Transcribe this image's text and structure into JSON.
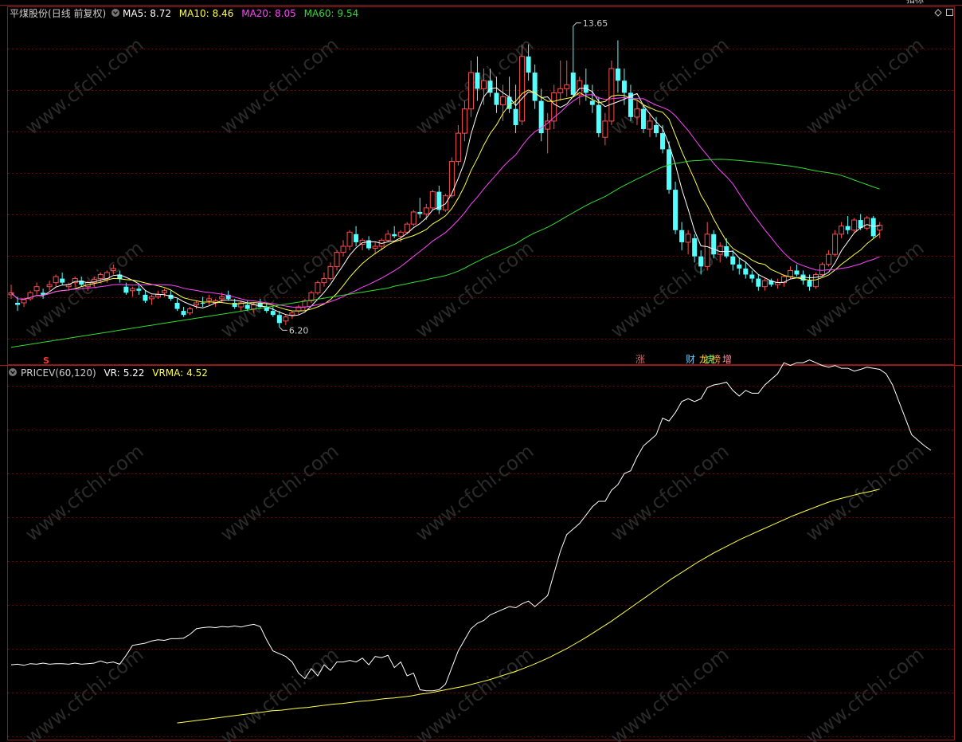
{
  "stock": {
    "name": "平煤股份",
    "period": "(日线 前复权)"
  },
  "toolbar_right": [
    "指标"
  ],
  "colors": {
    "background": "#000000",
    "grid": "#7a0000",
    "frame": "#8c1a1a",
    "up": "#ff4d4d",
    "down": "#54ffff",
    "ma5": "#ffffff",
    "ma10": "#ffff44",
    "ma20": "#ff44ff",
    "ma60": "#33dd33",
    "vr": "#ffffff",
    "vrma": "#ffff44",
    "label_grey": "#cccccc"
  },
  "main_indicators": [
    {
      "label": "MA5:",
      "value": "8.72",
      "color": "#ffffff"
    },
    {
      "label": "MA10:",
      "value": "8.46",
      "color": "#ffff44"
    },
    {
      "label": "MA20:",
      "value": "8.05",
      "color": "#ff44ff"
    },
    {
      "label": "MA60:",
      "value": "9.54",
      "color": "#33dd33"
    }
  ],
  "sub_indicator": {
    "name": "PRICEV(60,120)",
    "items": [
      {
        "label": "VR:",
        "value": "5.22",
        "color": "#ffffff"
      },
      {
        "label": "VRMA:",
        "value": "4.52",
        "color": "#ffff44"
      }
    ]
  },
  "markers": {
    "high_label": "13.65",
    "low_label": "6.20",
    "s_label": "S",
    "zhang": "涨",
    "cai": "财",
    "long": "龙",
    "hu": "虎",
    "bang": "榜",
    "zeng": "增"
  },
  "watermark": "www.cfchi.com",
  "chart_data": [
    {
      "type": "candlestick",
      "title": "平煤股份 (日线 前复权)",
      "price_range": [
        5.3,
        14.1
      ],
      "high": {
        "index": 88,
        "value": 13.65
      },
      "low": {
        "index": 42,
        "value": 6.2
      },
      "candles": [
        [
          7.0,
          7.25,
          6.9,
          7.05
        ],
        [
          6.8,
          6.95,
          6.6,
          6.75
        ],
        [
          6.8,
          6.9,
          6.7,
          6.88
        ],
        [
          6.9,
          7.1,
          6.85,
          7.05
        ],
        [
          7.1,
          7.3,
          7.0,
          7.2
        ],
        [
          7.05,
          7.15,
          6.9,
          7.0
        ],
        [
          7.2,
          7.35,
          7.1,
          7.25
        ],
        [
          7.3,
          7.5,
          7.2,
          7.45
        ],
        [
          7.4,
          7.55,
          7.25,
          7.3
        ],
        [
          7.2,
          7.3,
          7.1,
          7.25
        ],
        [
          7.3,
          7.45,
          7.2,
          7.4
        ],
        [
          7.35,
          7.45,
          7.2,
          7.25
        ],
        [
          7.2,
          7.35,
          7.1,
          7.3
        ],
        [
          7.3,
          7.45,
          7.2,
          7.38
        ],
        [
          7.4,
          7.55,
          7.3,
          7.5
        ],
        [
          7.4,
          7.6,
          7.3,
          7.55
        ],
        [
          7.6,
          7.75,
          7.5,
          7.65
        ],
        [
          7.5,
          7.6,
          7.3,
          7.4
        ],
        [
          7.2,
          7.3,
          7.0,
          7.05
        ],
        [
          7.1,
          7.2,
          6.95,
          7.15
        ],
        [
          7.15,
          7.25,
          7.0,
          7.1
        ],
        [
          7.0,
          7.1,
          6.8,
          6.85
        ],
        [
          6.9,
          7.0,
          6.75,
          6.95
        ],
        [
          6.95,
          7.1,
          6.9,
          7.0
        ],
        [
          7.05,
          7.15,
          6.95,
          7.1
        ],
        [
          7.0,
          7.1,
          6.85,
          6.9
        ],
        [
          6.8,
          6.9,
          6.6,
          6.65
        ],
        [
          6.6,
          6.7,
          6.45,
          6.5
        ],
        [
          6.55,
          6.7,
          6.5,
          6.65
        ],
        [
          6.75,
          6.85,
          6.65,
          6.8
        ],
        [
          6.8,
          6.95,
          6.7,
          6.78
        ],
        [
          6.85,
          7.0,
          6.75,
          6.9
        ],
        [
          6.8,
          6.9,
          6.7,
          6.85
        ],
        [
          6.9,
          7.05,
          6.8,
          6.95
        ],
        [
          7.0,
          7.1,
          6.85,
          6.9
        ],
        [
          6.8,
          6.9,
          6.65,
          6.7
        ],
        [
          6.7,
          6.85,
          6.6,
          6.8
        ],
        [
          6.75,
          6.85,
          6.6,
          6.65
        ],
        [
          6.65,
          6.8,
          6.55,
          6.75
        ],
        [
          6.8,
          6.9,
          6.65,
          6.7
        ],
        [
          6.7,
          6.8,
          6.55,
          6.6
        ],
        [
          6.6,
          6.7,
          6.45,
          6.5
        ],
        [
          6.5,
          6.6,
          6.2,
          6.3
        ],
        [
          6.35,
          6.5,
          6.25,
          6.45
        ],
        [
          6.5,
          6.6,
          6.4,
          6.55
        ],
        [
          6.6,
          6.75,
          6.5,
          6.7
        ],
        [
          6.7,
          6.9,
          6.6,
          6.85
        ],
        [
          6.85,
          7.1,
          6.8,
          7.05
        ],
        [
          7.05,
          7.35,
          7.0,
          7.3
        ],
        [
          7.3,
          7.55,
          7.2,
          7.4
        ],
        [
          7.4,
          7.8,
          7.35,
          7.7
        ],
        [
          7.7,
          8.1,
          7.6,
          8.05
        ],
        [
          8.05,
          8.35,
          7.95,
          8.2
        ],
        [
          8.2,
          8.6,
          8.1,
          8.55
        ],
        [
          8.5,
          8.7,
          8.2,
          8.3
        ],
        [
          8.25,
          8.4,
          8.1,
          8.35
        ],
        [
          8.35,
          8.45,
          8.1,
          8.15
        ],
        [
          8.15,
          8.3,
          8.0,
          8.2
        ],
        [
          8.2,
          8.4,
          8.1,
          8.35
        ],
        [
          8.35,
          8.6,
          8.3,
          8.5
        ],
        [
          8.5,
          8.7,
          8.4,
          8.45
        ],
        [
          8.45,
          8.6,
          8.3,
          8.55
        ],
        [
          8.55,
          8.8,
          8.5,
          8.75
        ],
        [
          8.75,
          9.1,
          8.7,
          9.05
        ],
        [
          9.05,
          9.4,
          8.9,
          9.0
        ],
        [
          9.0,
          9.25,
          8.85,
          9.15
        ],
        [
          9.15,
          9.6,
          9.1,
          9.55
        ],
        [
          9.55,
          9.7,
          9.0,
          9.1
        ],
        [
          9.1,
          9.5,
          9.05,
          9.45
        ],
        [
          9.45,
          10.4,
          9.4,
          10.3
        ],
        [
          10.3,
          11.2,
          10.2,
          11.0
        ],
        [
          11.0,
          11.8,
          10.8,
          11.6
        ],
        [
          11.6,
          12.8,
          11.4,
          12.5
        ],
        [
          12.5,
          12.9,
          11.8,
          12.1
        ],
        [
          12.1,
          12.6,
          11.7,
          12.3
        ],
        [
          12.3,
          12.6,
          11.9,
          12.0
        ],
        [
          12.0,
          12.4,
          11.5,
          11.7
        ],
        [
          11.7,
          12.2,
          11.3,
          11.9
        ],
        [
          11.9,
          12.4,
          11.5,
          11.6
        ],
        [
          11.6,
          12.2,
          11.0,
          11.2
        ],
        [
          11.3,
          13.2,
          11.2,
          12.9
        ],
        [
          12.9,
          13.2,
          12.3,
          12.5
        ],
        [
          12.5,
          12.7,
          11.6,
          11.8
        ],
        [
          11.8,
          12.1,
          10.8,
          11.0
        ],
        [
          11.1,
          11.5,
          10.5,
          11.3
        ],
        [
          11.3,
          12.2,
          11.1,
          12.0
        ],
        [
          12.0,
          12.8,
          11.8,
          12.1
        ],
        [
          12.1,
          12.8,
          11.9,
          12.2
        ],
        [
          12.5,
          13.65,
          11.9,
          11.95
        ],
        [
          11.95,
          12.4,
          11.7,
          12.3
        ],
        [
          12.2,
          12.6,
          11.8,
          12.0
        ],
        [
          11.8,
          12.2,
          11.5,
          11.7
        ],
        [
          11.7,
          11.9,
          10.9,
          11.0
        ],
        [
          10.9,
          11.5,
          10.7,
          11.3
        ],
        [
          11.3,
          12.8,
          11.2,
          12.6
        ],
        [
          12.6,
          13.3,
          12.0,
          12.3
        ],
        [
          12.3,
          12.6,
          11.7,
          12.0
        ],
        [
          12.0,
          12.2,
          11.3,
          11.4
        ],
        [
          11.4,
          11.8,
          11.2,
          11.6
        ],
        [
          11.6,
          11.7,
          11.0,
          11.1
        ],
        [
          11.1,
          11.5,
          10.9,
          11.3
        ],
        [
          11.2,
          11.4,
          10.9,
          11.0
        ],
        [
          11.0,
          11.2,
          10.5,
          10.6
        ],
        [
          10.6,
          10.8,
          9.5,
          9.6
        ],
        [
          9.6,
          9.8,
          8.5,
          8.6
        ],
        [
          8.6,
          8.8,
          8.1,
          8.3
        ],
        [
          8.3,
          8.6,
          8.0,
          8.5
        ],
        [
          8.4,
          8.5,
          7.8,
          7.95
        ],
        [
          7.95,
          8.1,
          7.5,
          7.7
        ],
        [
          7.7,
          8.8,
          7.6,
          8.5
        ],
        [
          8.5,
          8.6,
          7.9,
          8.0
        ],
        [
          8.0,
          8.3,
          7.8,
          8.2
        ],
        [
          8.2,
          8.4,
          7.9,
          7.95
        ],
        [
          7.95,
          8.1,
          7.6,
          7.75
        ],
        [
          7.75,
          7.9,
          7.5,
          7.65
        ],
        [
          7.65,
          7.8,
          7.4,
          7.5
        ],
        [
          7.5,
          7.6,
          7.3,
          7.4
        ],
        [
          7.4,
          7.5,
          7.1,
          7.2
        ],
        [
          7.2,
          7.4,
          7.1,
          7.35
        ],
        [
          7.35,
          7.4,
          7.2,
          7.25
        ],
        [
          7.25,
          7.4,
          7.15,
          7.3
        ],
        [
          7.3,
          7.5,
          7.2,
          7.45
        ],
        [
          7.45,
          7.7,
          7.4,
          7.6
        ],
        [
          7.6,
          7.75,
          7.45,
          7.5
        ],
        [
          7.5,
          7.6,
          7.25,
          7.35
        ],
        [
          7.35,
          7.5,
          7.1,
          7.2
        ],
        [
          7.2,
          7.55,
          7.15,
          7.5
        ],
        [
          7.5,
          7.8,
          7.45,
          7.75
        ],
        [
          7.75,
          8.1,
          7.7,
          8.0
        ],
        [
          8.0,
          8.6,
          7.95,
          8.5
        ],
        [
          8.5,
          8.8,
          8.4,
          8.7
        ],
        [
          8.7,
          8.95,
          8.5,
          8.6
        ],
        [
          8.6,
          8.9,
          8.55,
          8.85
        ],
        [
          8.85,
          9.0,
          8.6,
          8.65
        ],
        [
          8.65,
          8.95,
          8.6,
          8.9
        ],
        [
          8.9,
          8.95,
          8.4,
          8.45
        ],
        [
          8.6,
          8.8,
          8.4,
          8.72
        ]
      ],
      "series": [
        {
          "name": "MA5",
          "period": 5
        },
        {
          "name": "MA10",
          "period": 10
        },
        {
          "name": "MA20",
          "period": 20
        },
        {
          "name": "MA60",
          "period": 60
        }
      ]
    },
    {
      "type": "line",
      "title": "PRICEV(60,120)",
      "y_range": [
        0,
        6.5
      ],
      "series": [
        {
          "name": "VR",
          "values": [
            1.35,
            1.36,
            1.34,
            1.37,
            1.36,
            1.38,
            1.36,
            1.37,
            1.37,
            1.36,
            1.38,
            1.36,
            1.37,
            1.38,
            1.42,
            1.38,
            1.4,
            1.36,
            1.52,
            1.7,
            1.72,
            1.74,
            1.78,
            1.8,
            1.79,
            1.82,
            1.82,
            1.83,
            1.9,
            2.0,
            2.02,
            2.03,
            2.02,
            2.04,
            2.03,
            2.05,
            2.03,
            2.06,
            2.08,
            2.04,
            1.8,
            1.6,
            1.55,
            1.5,
            1.4,
            1.2,
            1.1,
            1.28,
            1.15,
            1.35,
            1.25,
            1.4,
            1.4,
            1.43,
            1.4,
            1.47,
            1.35,
            1.5,
            1.48,
            1.52,
            1.3,
            1.4,
            1.15,
            1.2,
            0.9,
            0.88,
            0.88,
            0.9,
            1.0,
            1.3,
            1.6,
            1.8,
            2.0,
            2.1,
            2.15,
            2.25,
            2.3,
            2.35,
            2.4,
            2.38,
            2.45,
            2.5,
            2.4,
            2.5,
            2.6,
            3.0,
            3.4,
            3.7,
            3.8,
            3.9,
            4.05,
            4.2,
            4.3,
            4.3,
            4.5,
            4.6,
            4.8,
            4.85,
            5.1,
            5.3,
            5.4,
            5.5,
            5.8,
            5.75,
            5.9,
            6.1,
            6.15,
            6.1,
            6.15,
            6.35,
            6.4,
            6.42,
            6.45,
            6.3,
            6.2,
            6.3,
            6.25,
            6.25,
            6.4,
            6.5,
            6.6,
            6.8,
            6.75,
            6.8,
            6.8,
            6.85,
            6.8,
            6.75,
            6.72,
            6.75,
            6.7,
            6.7,
            6.65,
            6.68,
            6.72,
            6.7,
            6.68,
            6.6,
            6.4,
            6.1,
            5.8,
            5.5,
            5.4,
            5.3,
            5.22
          ]
        },
        {
          "name": "VRMA",
          "start_index": 26,
          "values": [
            0.3,
            0.32,
            0.34,
            0.36,
            0.38,
            0.4,
            0.42,
            0.44,
            0.46,
            0.48,
            0.5,
            0.52,
            0.53,
            0.55,
            0.57,
            0.58,
            0.6,
            0.62,
            0.64,
            0.65,
            0.67,
            0.69,
            0.7,
            0.72,
            0.74,
            0.75,
            0.77,
            0.79,
            0.82,
            0.84,
            0.87,
            0.9,
            0.93,
            0.96,
            1.0,
            1.04,
            1.08,
            1.13,
            1.18,
            1.23,
            1.29,
            1.35,
            1.42,
            1.49,
            1.57,
            1.65,
            1.74,
            1.83,
            1.93,
            2.03,
            2.13,
            2.24,
            2.35,
            2.46,
            2.57,
            2.68,
            2.79,
            2.9,
            3.0,
            3.1,
            3.2,
            3.29,
            3.38,
            3.46,
            3.54,
            3.62,
            3.69,
            3.76,
            3.83,
            3.9,
            3.97,
            4.04,
            4.1,
            4.16,
            4.22,
            4.28,
            4.33,
            4.37,
            4.41,
            4.45,
            4.48,
            4.52
          ]
        }
      ]
    }
  ]
}
